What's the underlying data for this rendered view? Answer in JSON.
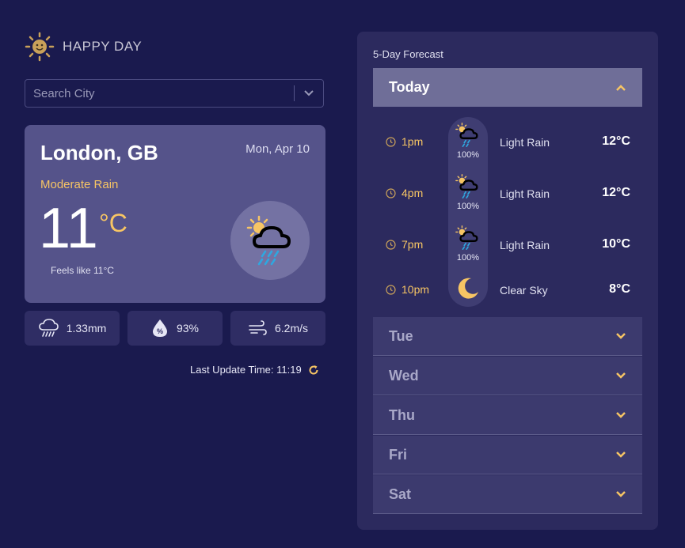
{
  "app": {
    "logo_text": "HAPPY DAY"
  },
  "search": {
    "placeholder": "Search City"
  },
  "current": {
    "city": "London, GB",
    "date": "Mon, Apr 10",
    "condition": "Moderate Rain",
    "temperature": "11",
    "unit": "°C",
    "feels_like": "Feels like 11°C",
    "icon": "sun-cloud-rain-icon"
  },
  "stats": {
    "precipitation": "1.33mm",
    "humidity": "93%",
    "wind": "6.2m/s"
  },
  "last_update": "Last Update Time: 11:19",
  "forecast": {
    "title": "5-Day Forecast",
    "today_label": "Today",
    "hourly": [
      {
        "time": "1pm",
        "pop": "100%",
        "desc": "Light Rain",
        "temp": "12°C",
        "icon": "sun-cloud-rain-icon"
      },
      {
        "time": "4pm",
        "pop": "100%",
        "desc": "Light Rain",
        "temp": "12°C",
        "icon": "sun-cloud-rain-icon"
      },
      {
        "time": "7pm",
        "pop": "100%",
        "desc": "Light Rain",
        "temp": "10°C",
        "icon": "sun-cloud-rain-icon"
      },
      {
        "time": "10pm",
        "pop": "",
        "desc": "Clear Sky",
        "temp": "8°C",
        "icon": "moon-icon"
      }
    ],
    "days": [
      "Tue",
      "Wed",
      "Thu",
      "Fri",
      "Sat"
    ]
  },
  "colors": {
    "background": "#1a1a4e",
    "card": "#55538a",
    "accent": "#f7c564",
    "rain": "#2ea8e0"
  }
}
